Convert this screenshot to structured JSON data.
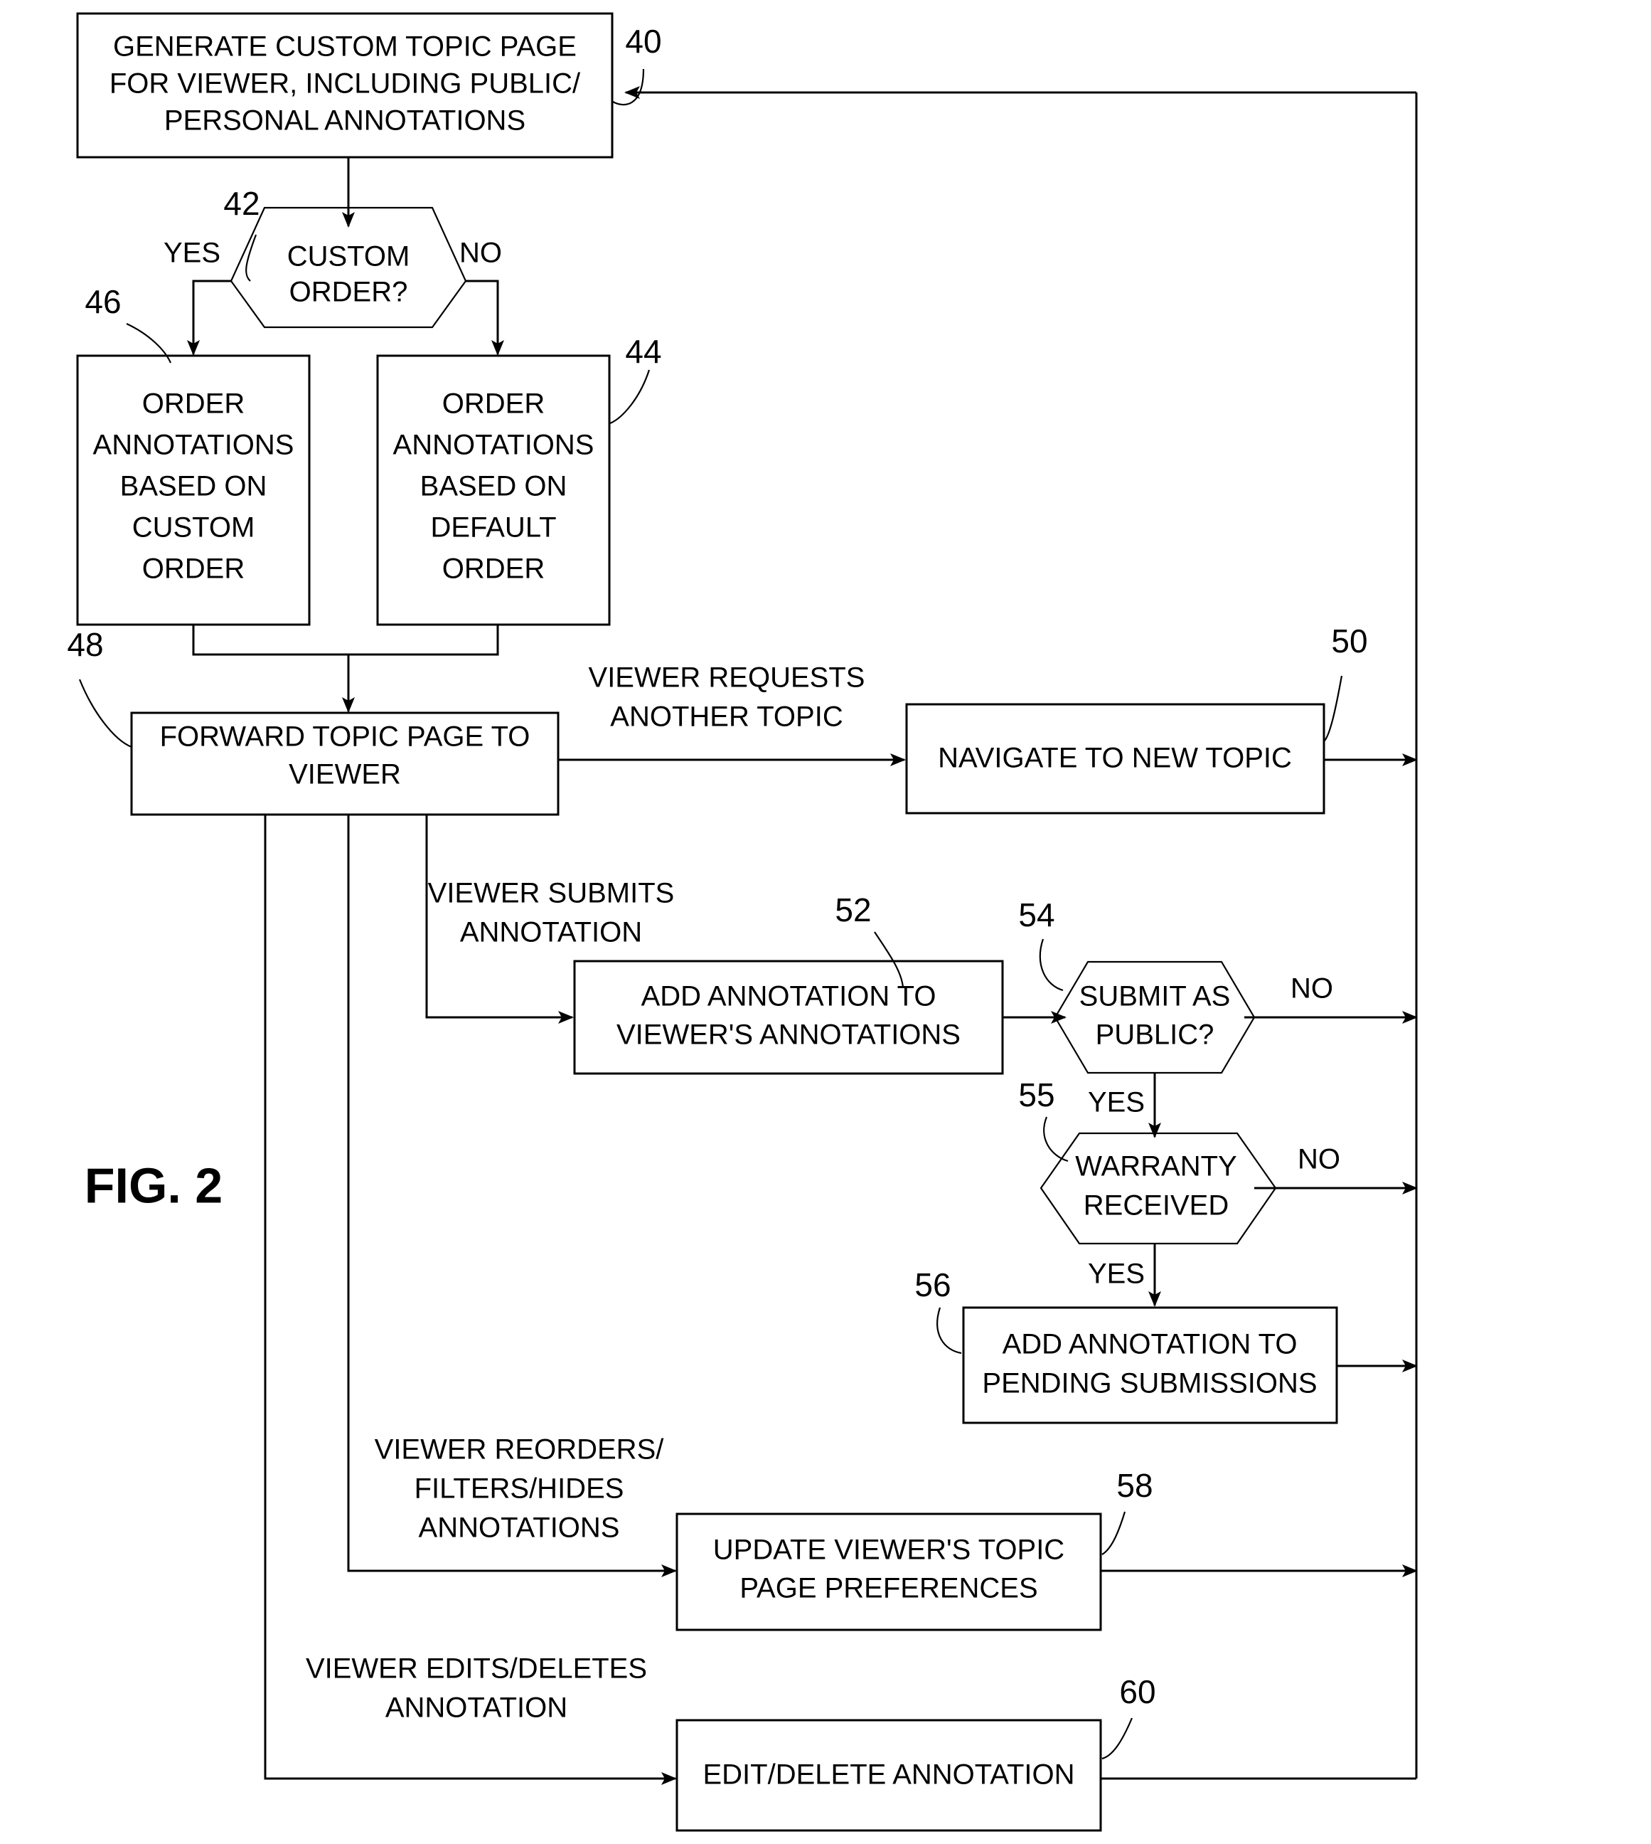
{
  "figure": {
    "label": "FIG. 2"
  },
  "nodes": [
    {
      "id": "n40",
      "ref": "40",
      "shape": "process",
      "lines": [
        "GENERATE CUSTOM TOPIC PAGE",
        "FOR VIEWER, INCLUDING PUBLIC/",
        "PERSONAL ANNOTATIONS"
      ]
    },
    {
      "id": "n42",
      "ref": "42",
      "shape": "decision",
      "lines": [
        "CUSTOM",
        "ORDER?"
      ]
    },
    {
      "id": "n46",
      "ref": "46",
      "shape": "process",
      "lines": [
        "ORDER",
        "ANNOTATIONS",
        "BASED ON",
        "CUSTOM",
        "ORDER"
      ]
    },
    {
      "id": "n44",
      "ref": "44",
      "shape": "process",
      "lines": [
        "ORDER",
        "ANNOTATIONS",
        "BASED ON",
        "DEFAULT",
        "ORDER"
      ]
    },
    {
      "id": "n48",
      "ref": "48",
      "shape": "process",
      "lines": [
        "FORWARD TOPIC PAGE TO",
        "VIEWER"
      ]
    },
    {
      "id": "n50",
      "ref": "50",
      "shape": "process",
      "lines": [
        "NAVIGATE TO NEW TOPIC"
      ]
    },
    {
      "id": "n52",
      "ref": "52",
      "shape": "process",
      "lines": [
        "ADD ANNOTATION TO",
        "VIEWER'S ANNOTATIONS"
      ]
    },
    {
      "id": "n54",
      "ref": "54",
      "shape": "decision",
      "lines": [
        "SUBMIT AS",
        "PUBLIC?"
      ]
    },
    {
      "id": "n55",
      "ref": "55",
      "shape": "decision",
      "lines": [
        "WARRANTY",
        "RECEIVED"
      ]
    },
    {
      "id": "n56",
      "ref": "56",
      "shape": "process",
      "lines": [
        "ADD ANNOTATION TO",
        "PENDING SUBMISSIONS"
      ]
    },
    {
      "id": "n58",
      "ref": "58",
      "shape": "process",
      "lines": [
        "UPDATE VIEWER'S TOPIC",
        "PAGE  PREFERENCES"
      ]
    },
    {
      "id": "n60",
      "ref": "60",
      "shape": "process",
      "lines": [
        "EDIT/DELETE ANNOTATION"
      ]
    }
  ],
  "edge_labels": {
    "custom_order_yes": "YES",
    "custom_order_no": "NO",
    "viewer_requests_l1": "VIEWER REQUESTS",
    "viewer_requests_l2": "ANOTHER TOPIC",
    "viewer_submits_l1": "VIEWER SUBMITS",
    "viewer_submits_l2": "ANNOTATION",
    "submit_public_no": "NO",
    "submit_public_yes": "YES",
    "warranty_no": "NO",
    "warranty_yes": "YES",
    "viewer_reorders_l1": "VIEWER REORDERS/",
    "viewer_reorders_l2": "FILTERS/HIDES",
    "viewer_reorders_l3": "ANNOTATIONS",
    "viewer_edits_l1": "VIEWER EDITS/DELETES",
    "viewer_edits_l2": "ANNOTATION"
  },
  "refs": {
    "r40": "40",
    "r42": "42",
    "r44": "44",
    "r46": "46",
    "r48": "48",
    "r50": "50",
    "r52": "52",
    "r54": "54",
    "r55": "55",
    "r56": "56",
    "r58": "58",
    "r60": "60"
  },
  "node_text": {
    "n40_l1": "GENERATE CUSTOM TOPIC PAGE",
    "n40_l2": "FOR VIEWER, INCLUDING PUBLIC/",
    "n40_l3": "PERSONAL ANNOTATIONS",
    "n42_l1": "CUSTOM",
    "n42_l2": "ORDER?",
    "n46_l1": "ORDER",
    "n46_l2": "ANNOTATIONS",
    "n46_l3": "BASED ON",
    "n46_l4": "CUSTOM",
    "n46_l5": "ORDER",
    "n44_l1": "ORDER",
    "n44_l2": "ANNOTATIONS",
    "n44_l3": "BASED ON",
    "n44_l4": "DEFAULT",
    "n44_l5": "ORDER",
    "n48_l1": "FORWARD TOPIC PAGE TO",
    "n48_l2": "VIEWER",
    "n50_l1": "NAVIGATE TO NEW TOPIC",
    "n52_l1": "ADD ANNOTATION TO",
    "n52_l2": "VIEWER'S ANNOTATIONS",
    "n54_l1": "SUBMIT AS",
    "n54_l2": "PUBLIC?",
    "n55_l1": "WARRANTY",
    "n55_l2": "RECEIVED",
    "n56_l1": "ADD ANNOTATION TO",
    "n56_l2": "PENDING SUBMISSIONS",
    "n58_l1": "UPDATE VIEWER'S TOPIC",
    "n58_l2": "PAGE  PREFERENCES",
    "n60_l1": "EDIT/DELETE ANNOTATION"
  },
  "colors": {
    "line": "#000000",
    "text": "#000000",
    "background": "#ffffff"
  }
}
